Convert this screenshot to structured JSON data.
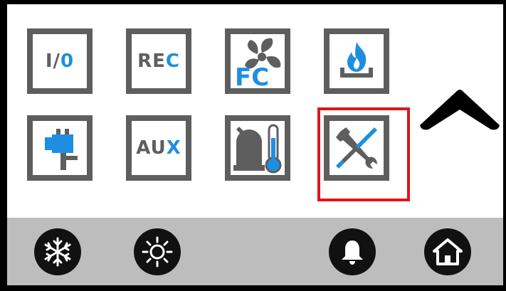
{
  "tiles": {
    "io": {
      "label_part1": "I/",
      "label_part2": "0",
      "icon": "io-icon"
    },
    "rec": {
      "label_part1": "RE",
      "label_part2": "C",
      "icon": "rec-icon"
    },
    "fc": {
      "label": "FC",
      "icon": "fan-fc-icon"
    },
    "burner": {
      "icon": "flame-burner-icon"
    },
    "valve": {
      "icon": "valve-icon"
    },
    "aux": {
      "label_part1": "AU",
      "label_part2": "X",
      "icon": "aux-icon"
    },
    "thermo": {
      "icon": "compressor-thermometer-icon"
    },
    "tools": {
      "icon": "wrench-screwdriver-icon",
      "selected": true
    }
  },
  "navigation": {
    "scroll_up_icon": "up-arrow-icon"
  },
  "bottom_bar": {
    "buttons": [
      {
        "name": "cooling-mode-button",
        "icon": "snowflake-icon"
      },
      {
        "name": "heating-mode-button",
        "icon": "sun-icon"
      },
      {
        "name": "alarm-button",
        "icon": "bell-icon"
      },
      {
        "name": "home-button",
        "icon": "home-icon"
      }
    ]
  },
  "colors": {
    "tile_border": "#5e5e5e",
    "accent_blue": "#1e8fe0",
    "selected_border": "#e0141b",
    "bottom_bar": "#bdbdbd"
  }
}
